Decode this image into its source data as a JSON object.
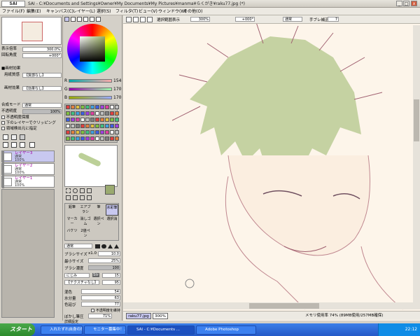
{
  "window": {
    "app_logo": "SAI",
    "title": "SAI - C:¥Documents and Settings¥Owner¥My Documents¥My Pictures¥manma¥らくがき¥raku77.jpg (*)",
    "minimize_label": "_",
    "maximize_label": "□",
    "close_label": "x"
  },
  "menubar": {
    "items": [
      "ファイル(F)",
      "編集(E)",
      "キャンバス(C)",
      "レイヤー(L)",
      "選択(S)",
      "フィルタ(T)",
      "ビュー(V)",
      "ウィンドウ(W)",
      "その他(O)"
    ]
  },
  "left_panel": {
    "zoom_label": "表示倍率",
    "zoom_value": "300.0%",
    "rotate_label": "回転角度",
    "rotate_value": "+000°",
    "paper_effect_header": "■画材効果",
    "paper_texture_label": "用紙質感",
    "paper_texture_value": "【質感なし】",
    "paper_effect_label": "画材効果",
    "paper_effect_value": "【効果なし】",
    "blend_mode_label": "合成モード",
    "blend_mode_value": "通常",
    "opacity_label": "不透明度",
    "opacity_value": "100%",
    "checkbox_protect": "不透明度保護",
    "checkbox_clip": "下のレイヤーでクリッピング",
    "checkbox_sample": "領域検出元に指定",
    "layers": [
      {
        "name": "レイヤー3",
        "mode": "通常",
        "opacity": "100%",
        "selected": true
      },
      {
        "name": "レイヤー2",
        "mode": "通常",
        "opacity": "100%",
        "selected": false
      },
      {
        "name": "レイヤー1",
        "mode": "通常",
        "opacity": "100%",
        "selected": false
      }
    ]
  },
  "tool_panel": {
    "rgb": {
      "r_label": "R",
      "r_value": "154",
      "g_label": "G",
      "g_value": "170",
      "b_label": "B",
      "b_value": "170"
    },
    "tools_row1": [
      "鉛筆",
      "エアブラシ",
      "筆",
      "水彩筆"
    ],
    "tools_row2": [
      "マーカー",
      "消しゴム",
      "選択ペン",
      "選択消"
    ],
    "tools_row3": [
      "バケツ",
      "2値ペン"
    ],
    "blend_label": "通常",
    "brush_size_label": "ブラシサイズ",
    "brush_size_mult": "x1.0",
    "brush_size_value": "10.0",
    "min_size_label": "最小サイズ",
    "min_size_value": "25%",
    "brush_density_label": "ブラシ濃度",
    "brush_density_value": "100",
    "edge_label": "にじみ",
    "edge_value": "Str",
    "edge_num": "15",
    "texture_label": "【テクスチャなし】",
    "texture_value": "95",
    "mix_label": "混色",
    "mix_value": "54",
    "water_label": "水分量",
    "water_value": "63",
    "persistence_label": "色延び",
    "persistence_value": "77",
    "keep_opacity_label": "不透明度を維持",
    "blur_label": "ぼかし筆圧",
    "blur_value": "71%",
    "detail_label": "詳細設定"
  },
  "canvas_toolbar": {
    "stabilizer_check": "選択範囲表示",
    "zoom_value": "300%",
    "angle_value": "+000°",
    "mode_value": "通常",
    "stabilizer_label": "手ブレ補正",
    "stabilizer_value": "7"
  },
  "status_bar": {
    "file_tab": "raku77.jpg",
    "zoom_tab": "300%",
    "memory_text": "メモリ使用率 74% (89MB使用/257MB確保)"
  },
  "taskbar": {
    "start_label": "スタート",
    "tasks": [
      {
        "label": "入れたずれ自身の描",
        "active": false
      },
      {
        "label": "モニター募集中！...",
        "active": false
      },
      {
        "label": "SAI - C:¥Documents ...",
        "active": true
      },
      {
        "label": "Adobe Photoshop",
        "active": false
      }
    ],
    "clock": "22:12"
  },
  "colors": {
    "ui_bg": "#d4d0c8",
    "selected_layer": "#c8c8f0",
    "hair_green": "#a8c080",
    "sketch_line": "#a06070",
    "canvas_bg": "#fbf3e8",
    "taskbar_blue": "#2459c7"
  }
}
